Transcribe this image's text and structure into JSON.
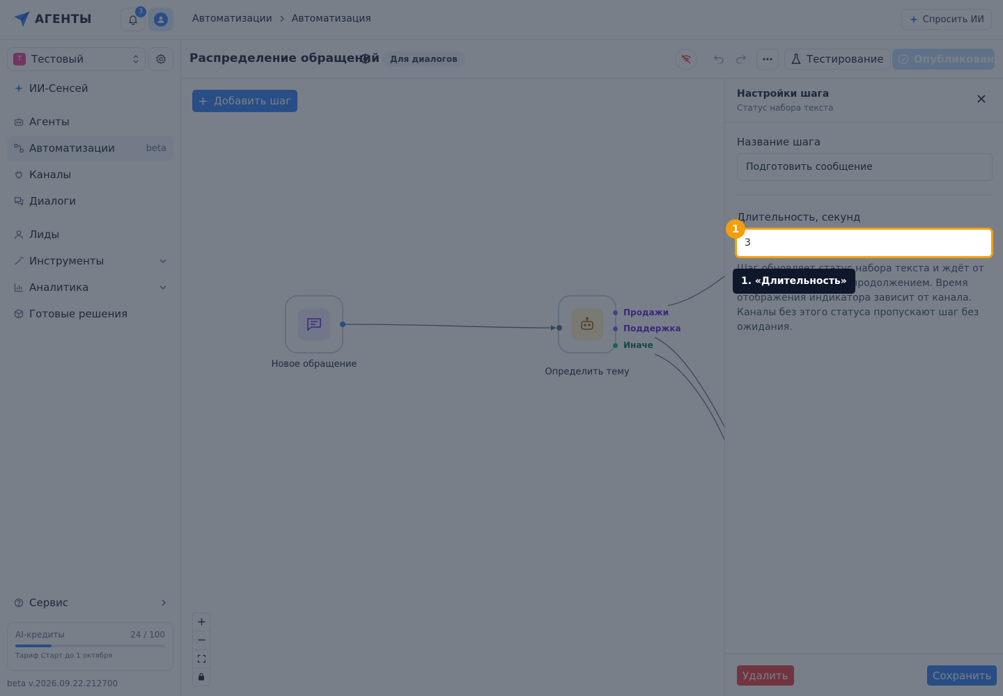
{
  "app": {
    "brand": "АГЕНТЫ",
    "notification_count": "3",
    "ask_ai_label": "Спросить ИИ"
  },
  "breadcrumb": [
    "Автоматизации",
    "Автоматизация"
  ],
  "sidebar": {
    "workspace": {
      "initial": "Т",
      "name": "Тестовый"
    },
    "items": [
      {
        "label": "ИИ-Сенсей",
        "icon": "sparkle-icon"
      },
      {
        "label": "Агенты",
        "icon": "bot-icon"
      },
      {
        "label": "Автоматизации",
        "icon": "automation-icon",
        "badge": "beta",
        "active": true
      },
      {
        "label": "Каналы",
        "icon": "plug-icon"
      },
      {
        "label": "Диалоги",
        "icon": "chat-icon"
      },
      {
        "label": "Лиды",
        "icon": "user-icon"
      },
      {
        "label": "Инструменты",
        "icon": "wand-icon",
        "expandable": true
      },
      {
        "label": "Аналитика",
        "icon": "bar-chart-icon",
        "expandable": true
      },
      {
        "label": "Готовые решения",
        "icon": "package-icon"
      }
    ],
    "service_label": "Сервис",
    "credits": {
      "label": "AI-кредиты",
      "count_text": "24 / 100",
      "used": 24,
      "total": 100,
      "plan": "Тариф Старт до 1 октября"
    },
    "version": "beta v.2026.09.22.212700"
  },
  "flow": {
    "title": "Распределение обращений",
    "tag": "Для диалогов",
    "test_label": "Тестирование",
    "published_label": "Опубликовано"
  },
  "canvas": {
    "add_step_label": "Добавить шаг",
    "nodes": [
      {
        "label": "Новое обращение",
        "icon": "message-square-icon"
      },
      {
        "label": "Определить тему",
        "icon": "bot-icon"
      }
    ],
    "branches": [
      {
        "label": "Продажи",
        "color": "#8b5cf6"
      },
      {
        "label": "Поддержка",
        "color": "#8b5cf6"
      },
      {
        "label": "Иначе",
        "color": "#10b981"
      }
    ]
  },
  "panel": {
    "title": "Настройки шага",
    "subtitle": "Статус набора текста",
    "name_label": "Название шага",
    "name_value": "Подготовить сообщение",
    "duration_label": "Длительность, секунд",
    "duration_value": "3",
    "help": "Шаг обновляет статус набора текста и ждёт от 1 до 10 секунд перед продолжением. Время отображения индикатора зависит от канала. Каналы без этого статуса пропускают шаг без ожидания.",
    "delete_label": "Удалить",
    "save_label": "Сохранить"
  },
  "highlight": {
    "marker": "1",
    "tooltip": "1. «Длительность»",
    "color": "#f59e0b"
  },
  "colors": {
    "accent": "#3b82f6",
    "danger": "#ef4444",
    "highlight": "#f59e0b"
  }
}
